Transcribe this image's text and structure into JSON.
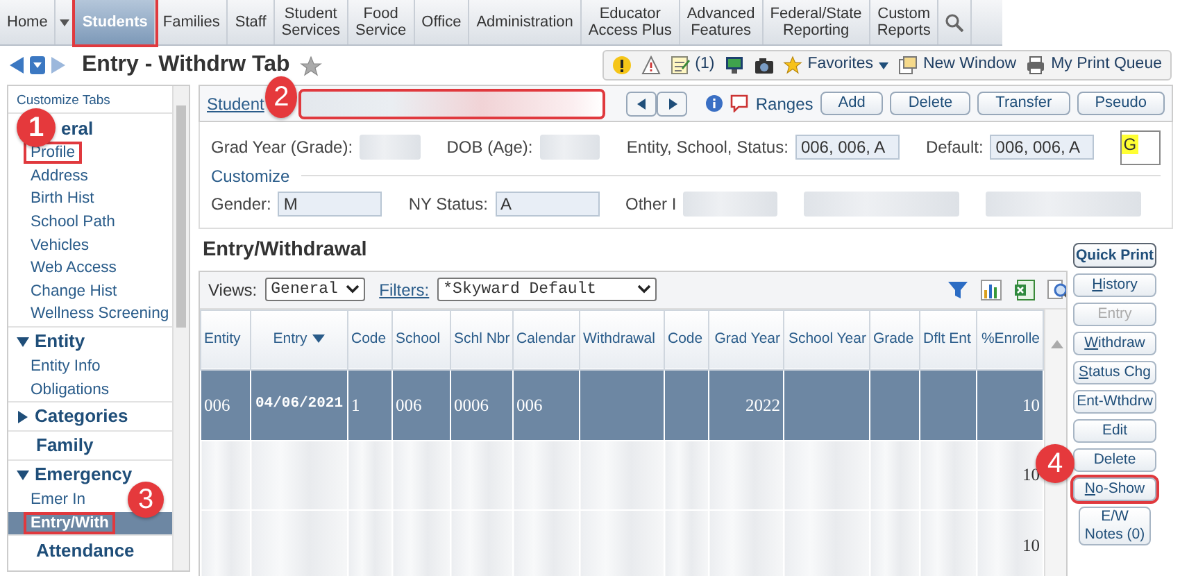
{
  "nav": {
    "tabs": [
      {
        "lines": [
          "Home"
        ],
        "selected": false,
        "highlighted": false,
        "dropdown": true
      },
      {
        "lines": [
          "Students"
        ],
        "selected": true,
        "highlighted": true,
        "dropdown": false
      },
      {
        "lines": [
          "Families"
        ],
        "selected": false,
        "highlighted": false,
        "dropdown": false
      },
      {
        "lines": [
          "Staff"
        ],
        "selected": false,
        "highlighted": false,
        "dropdown": false
      },
      {
        "lines": [
          "Student",
          "Services"
        ],
        "selected": false,
        "highlighted": false,
        "dropdown": false
      },
      {
        "lines": [
          "Food",
          "Service"
        ],
        "selected": false,
        "highlighted": false,
        "dropdown": false
      },
      {
        "lines": [
          "Office"
        ],
        "selected": false,
        "highlighted": false,
        "dropdown": false
      },
      {
        "lines": [
          "Administration"
        ],
        "selected": false,
        "highlighted": false,
        "dropdown": false
      },
      {
        "lines": [
          "Educator",
          "Access Plus"
        ],
        "selected": false,
        "highlighted": false,
        "dropdown": false
      },
      {
        "lines": [
          "Advanced",
          "Features"
        ],
        "selected": false,
        "highlighted": false,
        "dropdown": false
      },
      {
        "lines": [
          "Federal/State",
          "Reporting"
        ],
        "selected": false,
        "highlighted": false,
        "dropdown": false
      },
      {
        "lines": [
          "Custom",
          "Reports"
        ],
        "selected": false,
        "highlighted": false,
        "dropdown": false
      }
    ]
  },
  "header": {
    "title": "Entry - Withdrw Tab",
    "favorite": false,
    "toolbar": [
      {
        "kind": "alert"
      },
      {
        "kind": "warning"
      },
      {
        "kind": "notes",
        "label": "(1)"
      },
      {
        "kind": "monitor"
      },
      {
        "kind": "camera"
      },
      {
        "kind": "favorites",
        "label": "Favorites"
      },
      {
        "kind": "new-window",
        "label": "New Window"
      },
      {
        "kind": "print",
        "label": "My Print Queue"
      }
    ]
  },
  "sidebar": {
    "title": "Customize Tabs",
    "sections": [
      {
        "label": "eral",
        "kind": "toggle",
        "expanded": true,
        "callout": "1",
        "items": [
          {
            "label": "Profile",
            "selected": false,
            "highlighted": true
          },
          {
            "label": "Address",
            "selected": false,
            "highlighted": false
          },
          {
            "label": "Birth Hist",
            "selected": false,
            "highlighted": false
          },
          {
            "label": "School Path",
            "selected": false,
            "highlighted": false
          },
          {
            "label": "Vehicles",
            "selected": false,
            "highlighted": false
          },
          {
            "label": "Web Access",
            "selected": false,
            "highlighted": false
          },
          {
            "label": "Change Hist",
            "selected": false,
            "highlighted": false
          },
          {
            "label": "Wellness Screening",
            "selected": false,
            "highlighted": false
          }
        ]
      },
      {
        "label": "Entity",
        "kind": "toggle",
        "expanded": true,
        "items": [
          {
            "label": "Entity Info",
            "selected": false,
            "highlighted": false
          },
          {
            "label": "Obligations",
            "selected": false,
            "highlighted": false
          }
        ]
      },
      {
        "label": "Categories",
        "kind": "toggle",
        "expanded": false
      },
      {
        "label": "Family",
        "kind": "plain"
      },
      {
        "label": "Emergency",
        "kind": "toggle",
        "expanded": true,
        "items": [
          {
            "label": "Emer In",
            "selected": false,
            "highlighted": false
          },
          {
            "label": "Entry/With",
            "selected": true,
            "highlighted": true,
            "callout": "3"
          }
        ]
      },
      {
        "label": "Attendance",
        "kind": "plain"
      }
    ]
  },
  "student_bar": {
    "label": "Student",
    "callout": "2",
    "field_highlighted": true,
    "ranges": "Ranges",
    "buttons": [
      "Add",
      "Delete",
      "Transfer",
      "Pseudo"
    ]
  },
  "info": {
    "rows": [
      [
        {
          "label": "Grad Year (Grade):",
          "blurred": true
        },
        {
          "label": "DOB (Age):",
          "blurred": true
        },
        {
          "label": "Entity, School, Status:",
          "value": "006, 006, A",
          "blurred": false
        },
        {
          "label": "Default:",
          "value": "006, 006, A",
          "blurred": false
        }
      ],
      [
        {
          "label": "Gender:",
          "value": "M",
          "blurred": false
        },
        {
          "label": "NY Status:",
          "value": "A",
          "blurred": false
        },
        {
          "label": "Other I",
          "blurred": true
        },
        {
          "blurred": true
        },
        {
          "blurred": true
        }
      ]
    ],
    "flag": "G",
    "customize": "Customize"
  },
  "grid": {
    "title": "Entry/Withdrawal",
    "views_label": "Views:",
    "view": "General",
    "filters_label": "Filters:",
    "filter": "*Skyward Default",
    "columns": [
      {
        "label": "Entity",
        "kind": "text",
        "sorted": false
      },
      {
        "label": "Entry",
        "kind": "date",
        "sorted": true
      },
      {
        "label": "Code",
        "kind": "text",
        "sorted": false
      },
      {
        "label": "School",
        "kind": "text",
        "sorted": false
      },
      {
        "label": "Schl Nbr",
        "kind": "text",
        "sorted": false
      },
      {
        "label": "Calendar",
        "kind": "text",
        "sorted": false
      },
      {
        "label": "Withdrawal",
        "kind": "text",
        "sorted": false
      },
      {
        "label": "Code",
        "kind": "text",
        "sorted": false
      },
      {
        "label": "Grad Year",
        "kind": "number",
        "sorted": false
      },
      {
        "label": "School Year",
        "kind": "number",
        "sorted": false
      },
      {
        "label": "Grade",
        "kind": "text",
        "sorted": false
      },
      {
        "label": "Dflt Ent",
        "kind": "text",
        "sorted": false
      },
      {
        "label": "%Enrolle",
        "kind": "number",
        "sorted": false
      }
    ],
    "rows": [
      {
        "selected": true,
        "blurred": false,
        "cells": [
          "006",
          "04/06/2021",
          "1",
          "006",
          "0006",
          "006",
          null,
          null,
          "2022",
          null,
          null,
          null,
          "10"
        ]
      },
      {
        "selected": false,
        "blurred": true,
        "last_cell": "10"
      },
      {
        "selected": false,
        "blurred": true,
        "last_cell": "10"
      }
    ]
  },
  "actions": [
    {
      "label": "Quick Print",
      "kind": "bold",
      "accesskey": false,
      "disabled": false
    },
    {
      "label": "History",
      "kind": "normal",
      "accesskey": true,
      "disabled": false
    },
    {
      "label": "Entry",
      "kind": "normal",
      "accesskey": false,
      "disabled": true
    },
    {
      "label": "Withdraw",
      "kind": "normal",
      "accesskey": true,
      "disabled": false
    },
    {
      "label": "Status Chg",
      "kind": "normal",
      "accesskey": true,
      "disabled": false
    },
    {
      "label": "Ent-Wthdrw",
      "kind": "normal",
      "accesskey": false,
      "disabled": false
    },
    {
      "label": "Edit",
      "kind": "normal",
      "accesskey": false,
      "disabled": false
    },
    {
      "label": "Delete",
      "kind": "normal",
      "accesskey": false,
      "disabled": false
    },
    {
      "label": "No-Show",
      "kind": "normal",
      "accesskey": true,
      "disabled": false,
      "highlighted": true,
      "callout": "4"
    },
    {
      "label": "E/W Notes (0)",
      "kind": "normal",
      "accesskey": false,
      "disabled": false
    }
  ]
}
